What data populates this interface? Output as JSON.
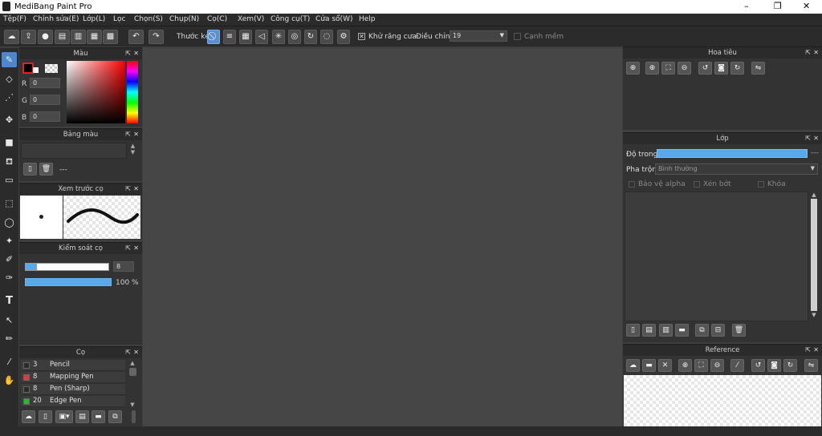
{
  "app": {
    "title": "MediBang Paint Pro",
    "minimize": "–",
    "maximize": "❐",
    "close": "✕"
  },
  "menu": [
    "Tệp(F)",
    "Chỉnh sửa(E)",
    "Lớp(L)",
    "Lọc",
    "Chọn(S)",
    "Chụp(N)",
    "Cọ(C)",
    "Xem(V)",
    "Công cụ(T)",
    "Cửa sổ(W)",
    "Help"
  ],
  "toolbar": {
    "ruler_label": "Thước kẻ",
    "antialias_label": "Khử răng cưa",
    "adjust_label": "Điều chỉnh",
    "adjust_value": "19",
    "smooth_label": "Cạnh mềm"
  },
  "color_panel": {
    "title": "Màu",
    "r_label": "R",
    "g_label": "G",
    "b_label": "B",
    "r": "0",
    "g": "0",
    "b": "0"
  },
  "palette_panel": {
    "title": "Bảng màu",
    "value": "---"
  },
  "brush_preview_panel": {
    "title": "Xem trước cọ"
  },
  "brush_control_panel": {
    "title": "Kiểm soát cọ",
    "size": "8",
    "opacity": "100 %"
  },
  "brush_panel": {
    "title": "Cọ",
    "items": [
      {
        "size": "3",
        "name": "Pencil",
        "color": "#2a2a2a"
      },
      {
        "size": "8",
        "name": "Mapping Pen",
        "color": "#e03a3a"
      },
      {
        "size": "8",
        "name": "Pen (Sharp)",
        "color": "#2a2a2a"
      },
      {
        "size": "20",
        "name": "Edge Pen",
        "color": "#22c022"
      }
    ]
  },
  "navigator_panel": {
    "title": "Hoa tiêu"
  },
  "layer_panel": {
    "title": "Lớp",
    "opacity_label": "Độ trong",
    "opacity_value": "---",
    "blend_label": "Pha trộn",
    "blend_value": "Bình thường",
    "protect_alpha": "Bảo vệ alpha",
    "clipping": "Xén bớt",
    "lock": "Khóa"
  },
  "reference_panel": {
    "title": "Reference"
  },
  "colors": {
    "accent": "#5aa8e8",
    "primary_color": "#000000",
    "hue_cursor": "#ff0000"
  }
}
